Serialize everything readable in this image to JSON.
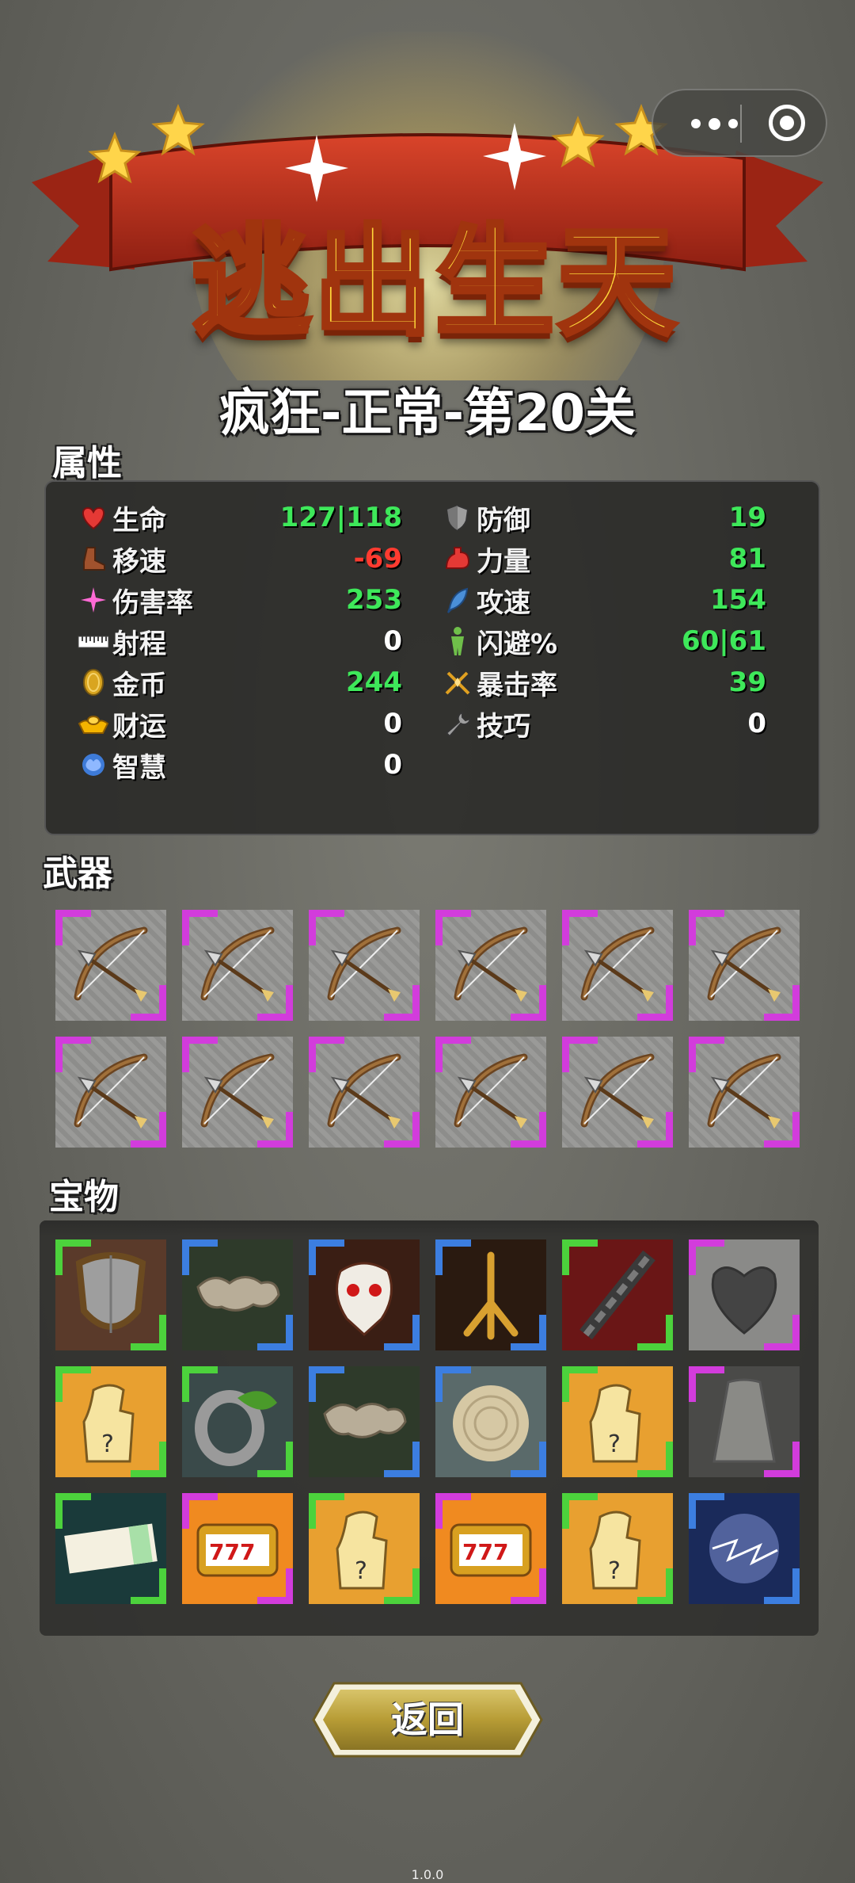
{
  "logo": {
    "title": "逃出生天"
  },
  "level_title": "疯狂-正常-第20关",
  "sections": {
    "attributes": "属性",
    "weapons": "武器",
    "treasures": "宝物"
  },
  "stats_left": [
    {
      "name": "生命",
      "value": "127|118",
      "value_color": "green",
      "name_color": "green",
      "icon": "heart-icon"
    },
    {
      "name": "移速",
      "value": "-69",
      "value_color": "red",
      "name_color": "red",
      "icon": "boot-icon"
    },
    {
      "name": "伤害率",
      "value": "253",
      "value_color": "green",
      "name_color": "green",
      "icon": "sparkle-icon"
    },
    {
      "name": "射程",
      "value": "0",
      "value_color": "white",
      "name_color": "white",
      "icon": "ruler-icon"
    },
    {
      "name": "金币",
      "value": "244",
      "value_color": "green",
      "name_color": "green",
      "icon": "coin-icon"
    },
    {
      "name": "财运",
      "value": "0",
      "value_color": "white",
      "name_color": "white",
      "icon": "gold-ingot-icon"
    },
    {
      "name": "智慧",
      "value": "0",
      "value_color": "white",
      "name_color": "white",
      "icon": "brain-icon"
    }
  ],
  "stats_right": [
    {
      "name": "防御",
      "value": "19",
      "value_color": "green",
      "name_color": "green",
      "icon": "shield-icon"
    },
    {
      "name": "力量",
      "value": "81",
      "value_color": "green",
      "name_color": "green",
      "icon": "muscle-icon"
    },
    {
      "name": "攻速",
      "value": "154",
      "value_color": "green",
      "name_color": "green",
      "icon": "feather-icon"
    },
    {
      "name": "闪避%",
      "value": "60|61",
      "value_color": "green",
      "name_color": "green",
      "icon": "dodge-figure-icon"
    },
    {
      "name": "暴击率",
      "value": "39",
      "value_color": "green",
      "name_color": "green",
      "icon": "crit-swords-icon"
    },
    {
      "name": "技巧",
      "value": "0",
      "value_color": "white",
      "name_color": "white",
      "icon": "wrench-icon"
    }
  ],
  "weapons": [
    {
      "icon": "bow-icon",
      "quality": "purple"
    },
    {
      "icon": "bow-icon",
      "quality": "purple"
    },
    {
      "icon": "bow-icon",
      "quality": "purple"
    },
    {
      "icon": "bow-icon",
      "quality": "purple"
    },
    {
      "icon": "bow-icon",
      "quality": "purple"
    },
    {
      "icon": "bow-icon",
      "quality": "purple"
    },
    {
      "icon": "bow-icon",
      "quality": "purple"
    },
    {
      "icon": "bow-icon",
      "quality": "purple"
    },
    {
      "icon": "bow-icon",
      "quality": "purple"
    },
    {
      "icon": "bow-icon",
      "quality": "purple"
    },
    {
      "icon": "bow-icon",
      "quality": "purple"
    },
    {
      "icon": "bow-icon",
      "quality": "purple"
    }
  ],
  "treasures": [
    {
      "icon": "wooden-shield-icon",
      "quality": "green"
    },
    {
      "icon": "stone-arm-icon",
      "quality": "blue"
    },
    {
      "icon": "demon-skull-mask-icon",
      "quality": "blue"
    },
    {
      "icon": "bird-claw-icon",
      "quality": "blue"
    },
    {
      "icon": "chain-icon",
      "quality": "green"
    },
    {
      "icon": "stone-heart-icon",
      "quality": "purple"
    },
    {
      "icon": "mystery-glove-icon",
      "quality": "green"
    },
    {
      "icon": "leaf-ring-icon",
      "quality": "green"
    },
    {
      "icon": "stone-arm-icon",
      "quality": "blue"
    },
    {
      "icon": "tree-ring-icon",
      "quality": "blue"
    },
    {
      "icon": "mystery-glove-icon",
      "quality": "green"
    },
    {
      "icon": "stone-cloak-icon",
      "quality": "purple"
    },
    {
      "icon": "ticket-icon",
      "quality": "green"
    },
    {
      "icon": "slot-machine-777-icon",
      "quality": "purple"
    },
    {
      "icon": "mystery-glove-icon",
      "quality": "green"
    },
    {
      "icon": "slot-machine-777-icon",
      "quality": "purple"
    },
    {
      "icon": "mystery-glove-icon",
      "quality": "green"
    },
    {
      "icon": "lightning-orb-icon",
      "quality": "blue"
    }
  ],
  "back_button": {
    "label": "返回"
  },
  "version": "1.0.0"
}
